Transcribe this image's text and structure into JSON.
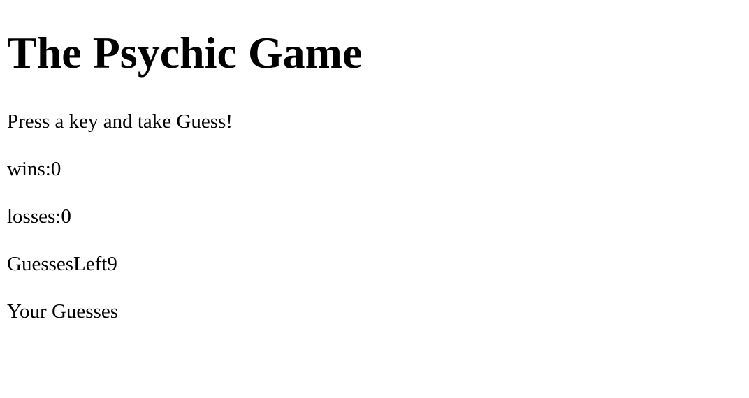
{
  "page": {
    "title": "The Psychic Game",
    "instructions": "Press a key and take Guess!",
    "wins": "wins:0",
    "losses": "losses:0",
    "guesses_left": "GuessesLeft9",
    "your_guesses": "Your Guesses"
  }
}
